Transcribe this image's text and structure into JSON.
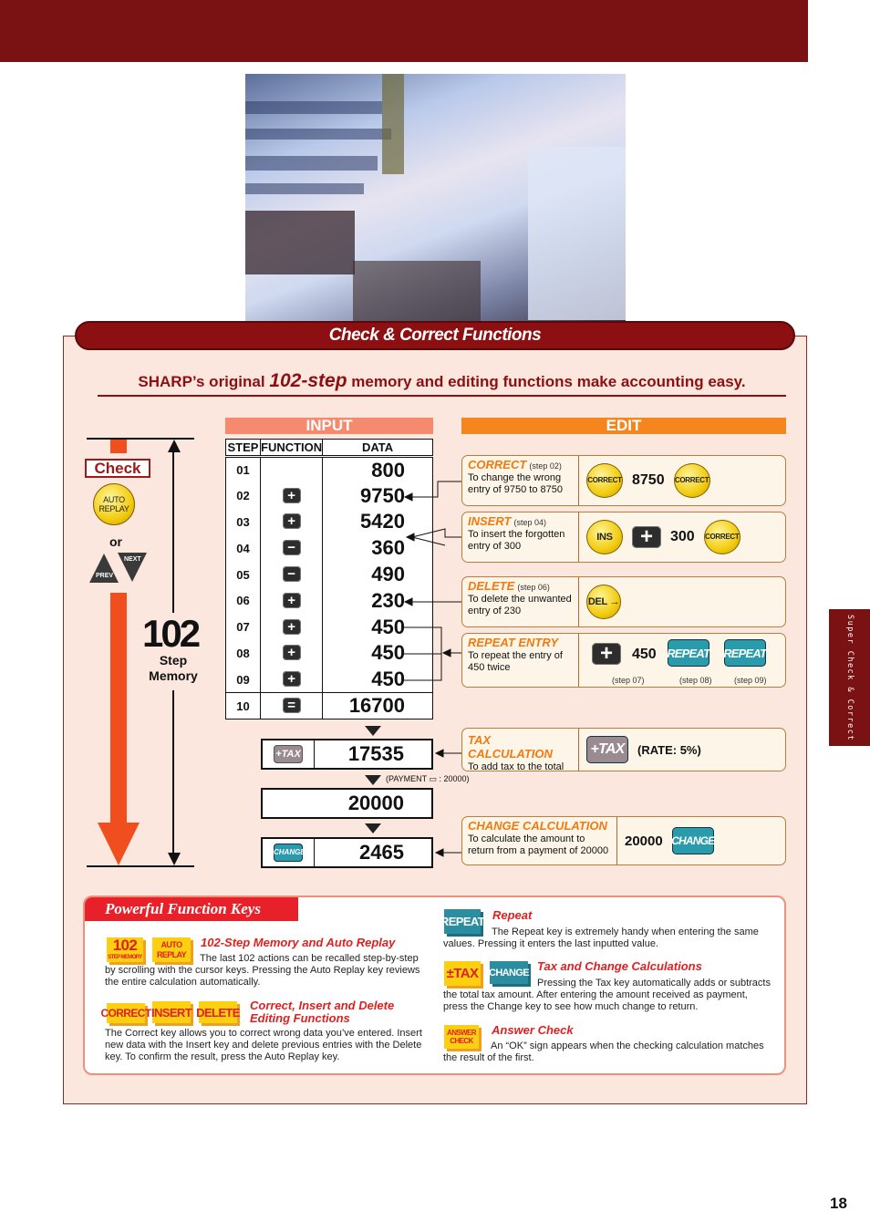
{
  "side_tab": "Super Check & Correct",
  "page_number": "18",
  "photo": {
    "description": "Businessman at desk with paperwork and calculator"
  },
  "banner_title": "Check & Correct Functions",
  "headline": {
    "pre": "SHARP’s original ",
    "highlight": "102-step",
    "post": " memory and editing functions make accounting easy."
  },
  "left": {
    "check_label": "Check",
    "auto_replay_key": "AUTO REPLAY",
    "or_label": "or",
    "next_key": "NEXT",
    "prev_key": "PREV",
    "big_number": "102",
    "big_caption_1": "Step",
    "big_caption_2": "Memory"
  },
  "input": {
    "header": "INPUT",
    "columns": [
      "STEP",
      "FUNCTION",
      "DATA"
    ],
    "rows": [
      {
        "step": "01",
        "function": "",
        "data": "800"
      },
      {
        "step": "02",
        "function": "+",
        "data": "9750"
      },
      {
        "step": "03",
        "function": "+",
        "data": "5420"
      },
      {
        "step": "04",
        "function": "−",
        "data": "360"
      },
      {
        "step": "05",
        "function": "−",
        "data": "490"
      },
      {
        "step": "06",
        "function": "+",
        "data": "230"
      },
      {
        "step": "07",
        "function": "+",
        "data": "450"
      },
      {
        "step": "08",
        "function": "+",
        "data": "450"
      },
      {
        "step": "09",
        "function": "+",
        "data": "450"
      },
      {
        "step": "10",
        "function": "=",
        "data": "16700"
      }
    ],
    "tax_key": "+TAX",
    "tax_result": "17535",
    "payment_note": "(PAYMENT ▭ : 20000)",
    "payment_value": "20000",
    "change_key": "CHANGE",
    "change_result": "2465"
  },
  "edit": {
    "header": "EDIT",
    "cards": [
      {
        "title": "CORRECT",
        "step": "(step 02)",
        "desc": "To change the wrong entry of 9750 to 8750",
        "keys": [
          "CORRECT",
          "8750",
          "CORRECT"
        ]
      },
      {
        "title": "INSERT",
        "step": "(step 04)",
        "desc": "To insert the forgotten entry of 300",
        "keys": [
          "INS",
          "+",
          "300",
          "CORRECT"
        ]
      },
      {
        "title": "DELETE",
        "step": "(step 06)",
        "desc": "To delete the unwanted entry of 230",
        "keys": [
          "DEL →"
        ]
      },
      {
        "title": "REPEAT ENTRY",
        "step": "",
        "desc": "To repeat the entry of 450 twice",
        "keys": [
          "+",
          "450",
          "REPEAT",
          "REPEAT"
        ],
        "notes": [
          "(step 07)",
          "(step 08)",
          "(step 09)"
        ]
      },
      {
        "title": "TAX CALCULATION",
        "step": "",
        "desc": "To add tax to the total",
        "keys": [
          "+TAX"
        ],
        "rate": "(RATE: 5%)"
      },
      {
        "title": "CHANGE CALCULATION",
        "step": "",
        "desc": "To calculate the amount to return from a payment of 20000",
        "keys": [
          "20000",
          "CHANGE"
        ]
      }
    ]
  },
  "function_keys": {
    "title": "Powerful Function Keys",
    "items": [
      {
        "keys": [
          "102",
          "STEP MEMORY",
          "AUTO",
          "REPLAY"
        ],
        "title": "102-Step Memory and Auto Replay",
        "text": "The last 102 actions can be recalled step-by-step by scrolling with the cursor keys. Pressing the Auto Replay key reviews the entire calculation automatically."
      },
      {
        "keys": [
          "CORRECT",
          "INSERT",
          "DELETE"
        ],
        "title": "Correct, Insert and Delete Editing Functions",
        "text": "The Correct key allows you to correct wrong data you’ve entered. Insert new data with the Insert key and delete previous entries with the Delete key. To confirm the result, press the Auto Replay key."
      },
      {
        "keys": [
          "REPEAT"
        ],
        "title": "Repeat",
        "text": "The Repeat key is extremely handy when entering the same values. Pressing it enters the last inputted value."
      },
      {
        "keys": [
          "±TAX",
          "CHANGE"
        ],
        "title": "Tax and Change Calculations",
        "text": "Pressing the Tax key automatically adds or subtracts the total tax amount. After entering the amount received as payment, press the Change key to see how much change to return."
      },
      {
        "keys": [
          "ANSWER",
          "CHECK"
        ],
        "title": "Answer Check",
        "text": "An “OK” sign appears when the checking calculation matches the result of the first."
      }
    ]
  }
}
